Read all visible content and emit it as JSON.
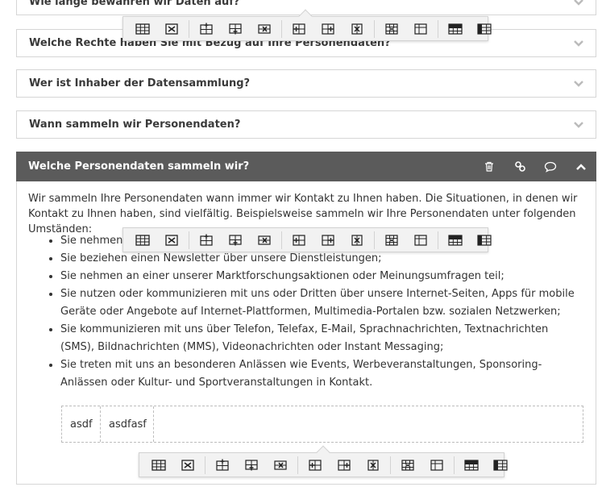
{
  "accordion": {
    "items": [
      {
        "title": "Wie lange bewahren wir Daten auf?"
      },
      {
        "title": "Welche Rechte haben Sie mit Bezug auf Ihre Personendaten?"
      },
      {
        "title": "Wer ist Inhaber der Datensammlung?"
      },
      {
        "title": "Wann sammeln wir Personendaten?"
      }
    ],
    "open_item": {
      "title": "Welche Personendaten sammeln wir?",
      "actions": [
        "trash-icon",
        "link-icon",
        "comment-icon",
        "chevron-up-icon"
      ],
      "intro": "Wir sammeln Ihre Personendaten wann immer wir Kontakt zu Ihnen haben. Die Situationen, in denen wir Kontakt zu Ihnen haben, sind vielfältig. Beispielsweise sammeln wir Ihre Personendaten unter folgenden Umständen:",
      "bullets": [
        "Sie nehmen e",
        "Sie beziehen einen Newsletter über unsere Dienstleistungen;",
        "Sie nehmen an einer unserer Marktforschungsaktionen oder Meinungsumfragen teil;",
        "Sie nutzen oder kommunizieren mit uns oder Dritten über unsere Internet-Seiten, Apps für mobile Geräte oder Angebote auf Internet-Plattformen, Multimedia-Portalen bzw. sozialen Netzwerken;",
        "Sie kommunizieren mit uns über Telefon, Telefax, E-Mail, Sprachnachrichten, Textnachrichten (SMS), Bildnachrichten (MMS), Videonachrichten oder Instant Messaging;",
        "Sie treten mit uns an besonderen Anlässen wie Events, Werbeveranstaltungen, Sponsoring-Anlässen oder Kultur- und Sportveranstaltungen in Kontakt."
      ],
      "table": {
        "cells": [
          "asdf",
          "asdfasf"
        ]
      }
    }
  },
  "table_toolbar": {
    "groups": [
      [
        "table-properties-icon",
        "delete-table-icon"
      ],
      [
        "insert-row-above-icon",
        "insert-row-below-icon",
        "delete-row-icon"
      ],
      [
        "insert-column-before-icon",
        "insert-column-after-icon",
        "delete-column-icon"
      ],
      [
        "merge-cells-icon",
        "split-cell-icon"
      ],
      [
        "header-row-icon",
        "header-column-icon"
      ]
    ]
  },
  "colors": {
    "open_header_bg": "#5b5b5b",
    "border": "#d6d6d6",
    "toolbar_bg": "#f2f2f2"
  }
}
